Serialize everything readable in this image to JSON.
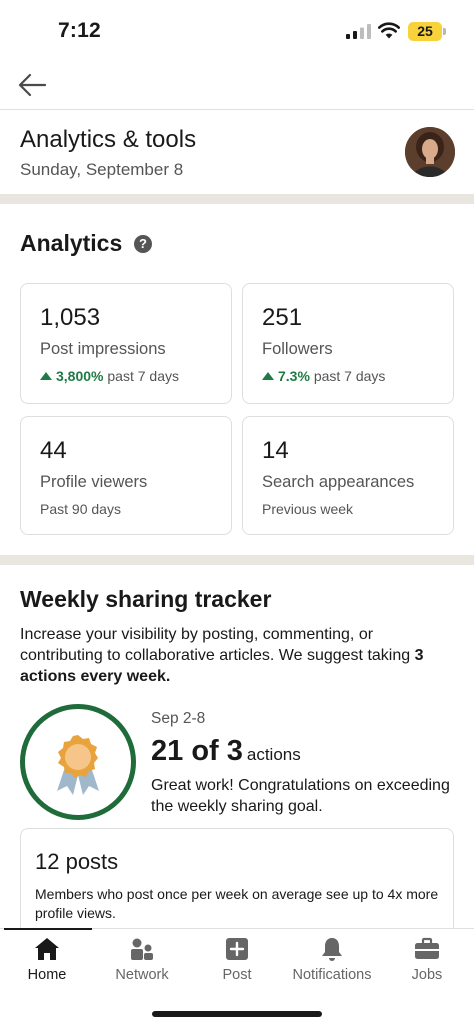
{
  "status_bar": {
    "time": "7:12",
    "battery": "25"
  },
  "header": {
    "back_icon": "arrow-left-icon"
  },
  "page": {
    "title": "Analytics & tools",
    "date": "Sunday, September 8"
  },
  "analytics": {
    "title": "Analytics",
    "help_icon": "?",
    "cards": [
      {
        "value": "1,053",
        "label": "Post impressions",
        "change": "3,800%",
        "change_suffix": "past 7 days",
        "trend": "up"
      },
      {
        "value": "251",
        "label": "Followers",
        "change": "7.3%",
        "change_suffix": "past 7 days",
        "trend": "up"
      },
      {
        "value": "44",
        "label": "Profile viewers",
        "sub": "Past 90 days"
      },
      {
        "value": "14",
        "label": "Search appearances",
        "sub": "Previous week"
      }
    ]
  },
  "tracker": {
    "title": "Weekly sharing tracker",
    "desc_prefix": "Increase your visibility by posting, commenting, or contributing to collaborative articles. We suggest taking ",
    "desc_bold": "3 actions every week.",
    "date_range": "Sep 2-8",
    "count": "21 of 3",
    "count_unit": "actions",
    "message": "Great work! Congratulations on exceeding the weekly sharing goal."
  },
  "posts_card": {
    "title": "12 posts",
    "desc": "Members who post once per week on average see up to 4x more profile views."
  },
  "tabs": [
    {
      "label": "Home",
      "icon": "home-icon",
      "active": true
    },
    {
      "label": "Network",
      "icon": "network-icon"
    },
    {
      "label": "Post",
      "icon": "post-plus-icon"
    },
    {
      "label": "Notifications",
      "icon": "bell-icon"
    },
    {
      "label": "Jobs",
      "icon": "briefcase-icon"
    }
  ],
  "colors": {
    "accent_green": "#1f7a45",
    "badge_ring": "#1f6b3a",
    "divider": "#e9e5df",
    "battery": "#f7d23a"
  }
}
